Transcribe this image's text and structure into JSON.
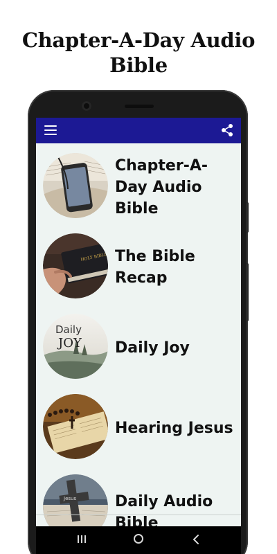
{
  "headline": {
    "line1": "Chapter-A-Day Audio",
    "line2": "Bible"
  },
  "appbar": {
    "color": "#1c1994",
    "menu_icon": "hamburger-menu-icon",
    "share_icon": "share-icon"
  },
  "items": [
    {
      "title": "Chapter-A-Day Audio Bible",
      "image": "phone-on-bible-photo"
    },
    {
      "title": "The Bible Recap",
      "image": "hand-on-holy-bible-photo",
      "book_text": "HOLY BIBLE"
    },
    {
      "title": "Daily Joy",
      "image": "daily-joy-landscape-logo",
      "logo_line1": "Daily",
      "logo_line2": "JOY"
    },
    {
      "title": "Hearing Jesus",
      "image": "rosary-on-open-bible-photo"
    },
    {
      "title": "Daily Audio Bible",
      "image": "jesus-cross-on-bible-photo",
      "cross_text": "Jesus"
    }
  ],
  "navbar": {
    "recents_icon": "recents-icon",
    "home_icon": "home-circle-icon",
    "back_icon": "back-triangle-icon"
  }
}
